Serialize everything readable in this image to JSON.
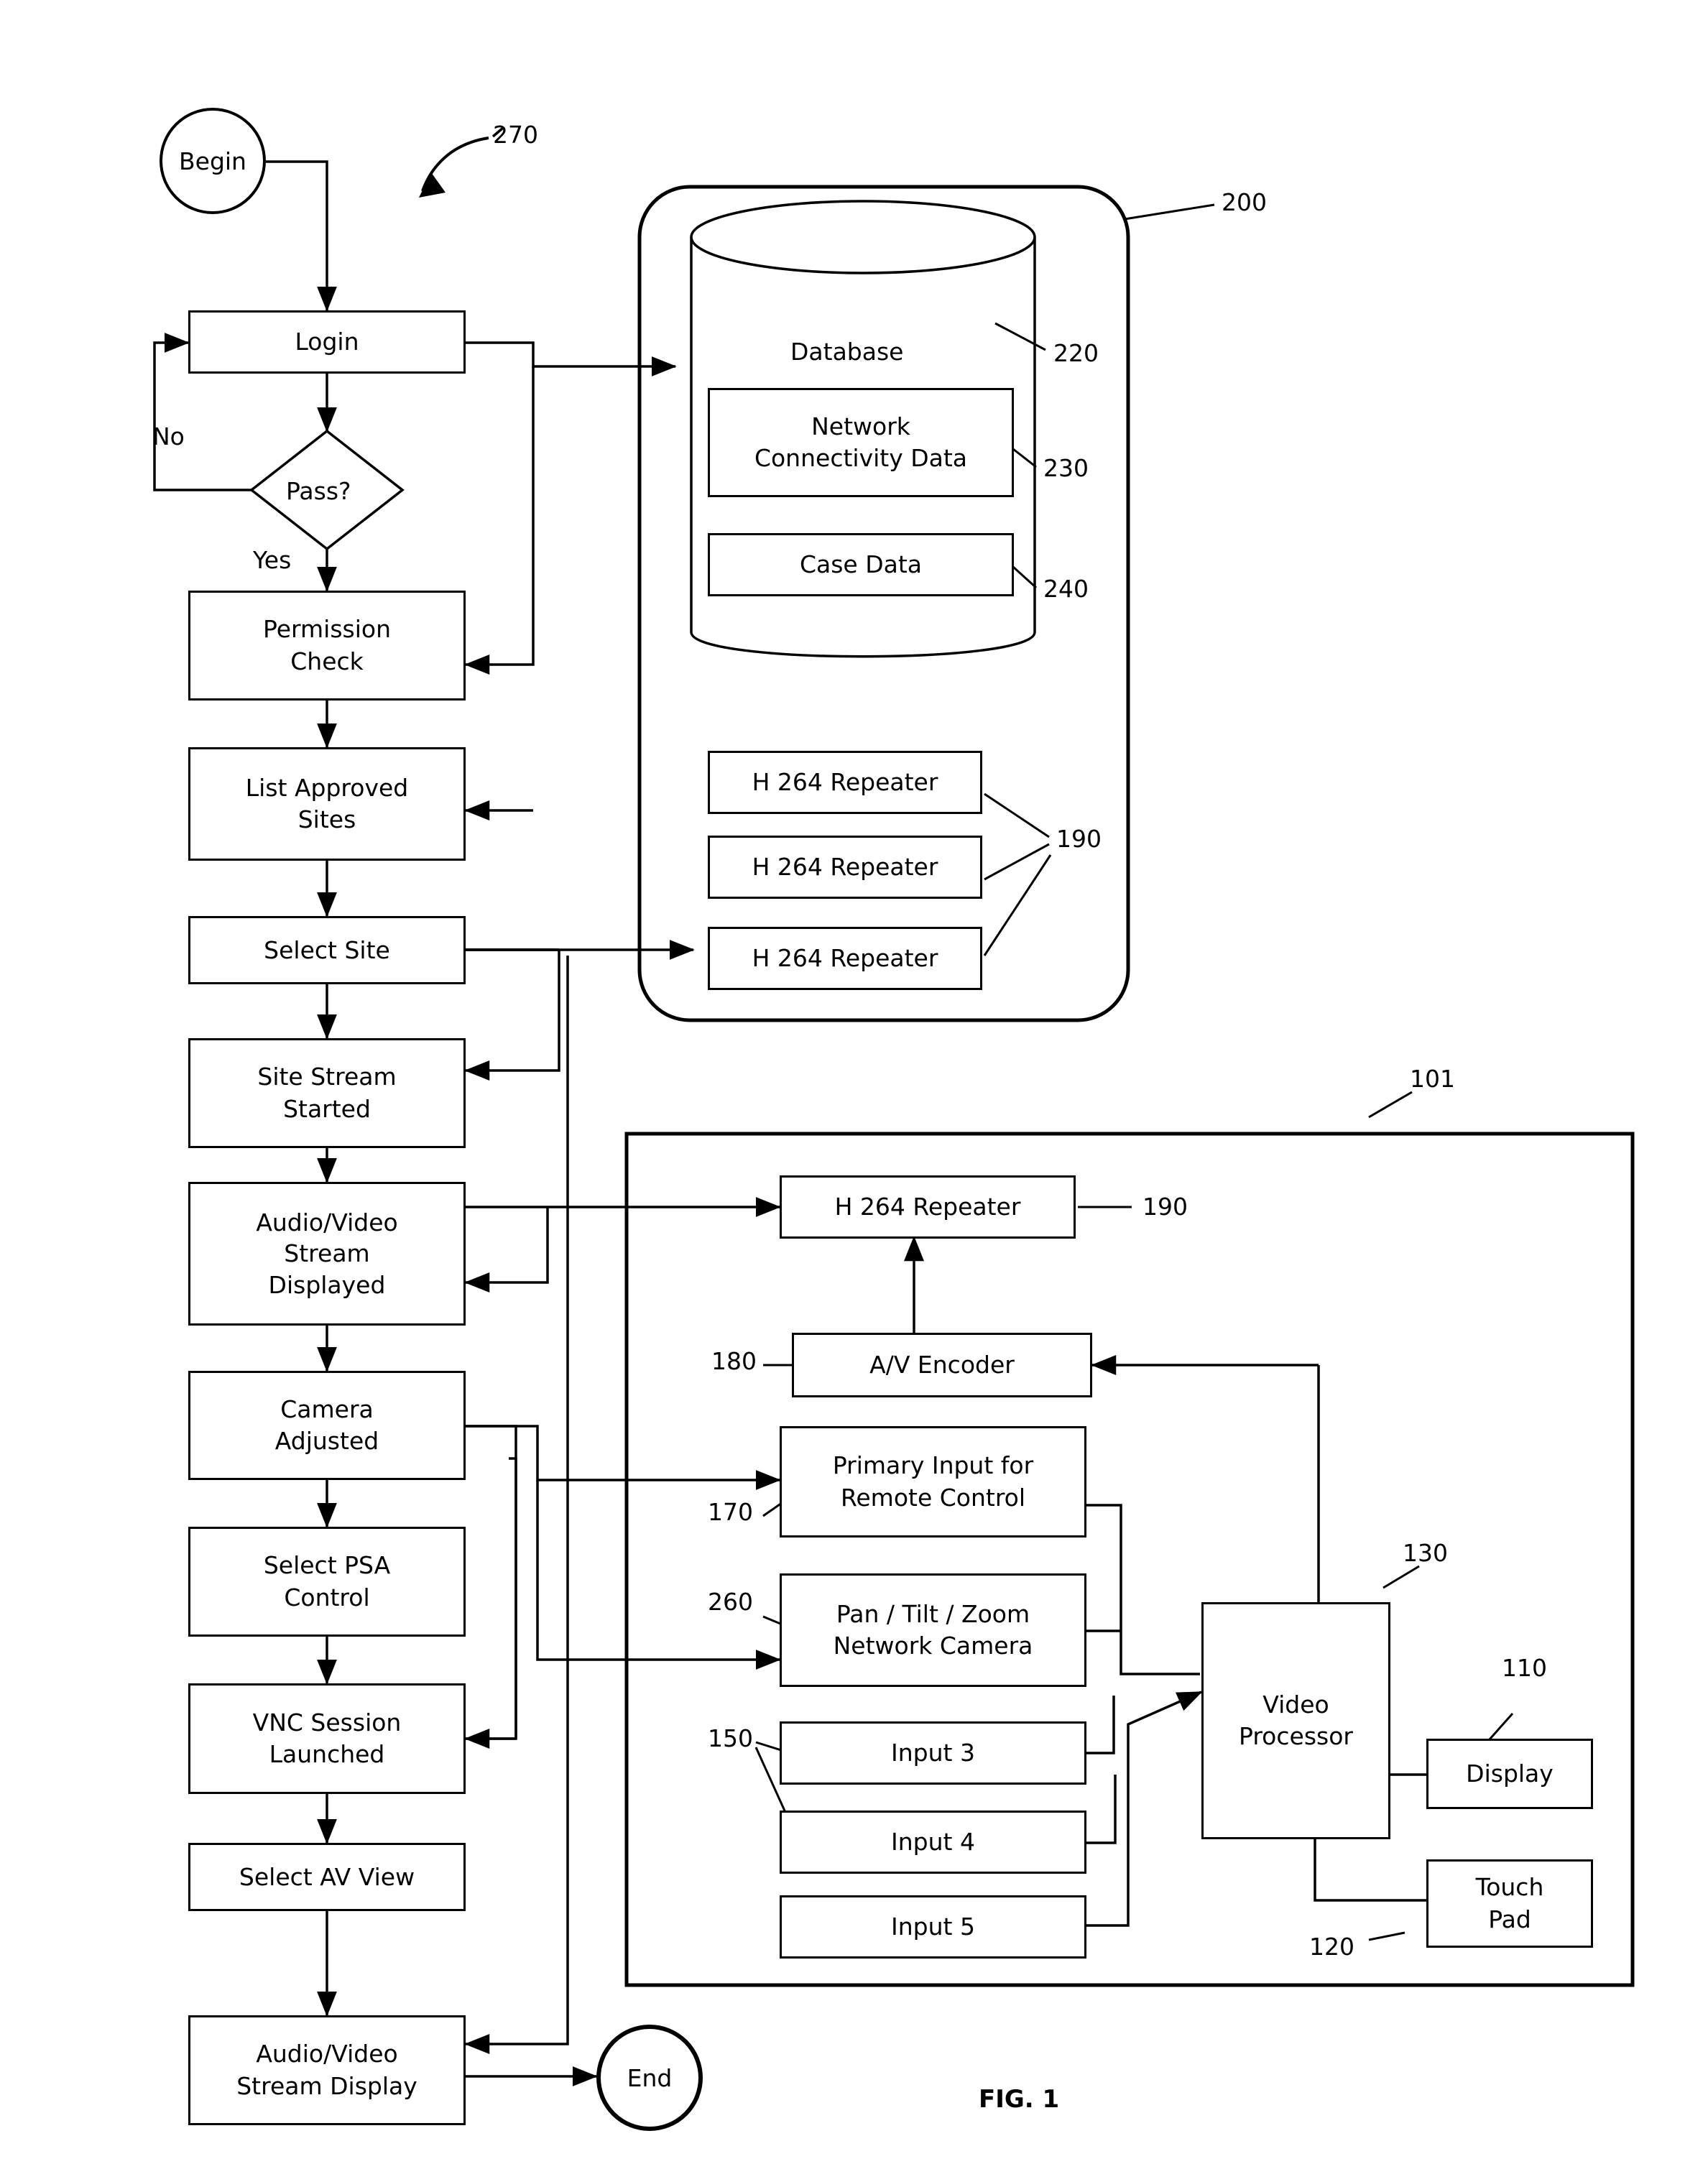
{
  "figure": {
    "caption": "FIG. 1",
    "flow_ref": "270",
    "server_ref": "200",
    "client_ref": "101"
  },
  "flow": {
    "begin": "Begin",
    "end": "End",
    "decision": "Pass?",
    "decision_no": "No",
    "decision_yes": "Yes",
    "steps": [
      {
        "label": "Login"
      },
      {
        "label": "Permission\nCheck",
        "line1": "Permission",
        "line2": "Check"
      },
      {
        "label": "List Approved\nSites",
        "line1": "List Approved",
        "line2": "Sites"
      },
      {
        "label": "Select Site"
      },
      {
        "label": "Site Stream\nStarted",
        "line1": "Site Stream",
        "line2": "Started"
      },
      {
        "label": "Audio/Video\nStream\nDisplayed",
        "line1": "Audio/Video",
        "line2": "Stream",
        "line3": "Displayed"
      },
      {
        "label": "Camera\nAdjusted",
        "line1": "Camera",
        "line2": "Adjusted"
      },
      {
        "label": "Select PSA\nControl",
        "line1": "Select PSA",
        "line2": "Control"
      },
      {
        "label": "VNC Session\nLaunched",
        "line1": "VNC Session",
        "line2": "Launched"
      },
      {
        "label": "Select AV View"
      },
      {
        "label": "Audio/Video\nStream Display",
        "line1": "Audio/Video",
        "line2": "Stream Display"
      }
    ]
  },
  "server": {
    "database_label": "Database",
    "database_ref": "220",
    "items": [
      {
        "label": "Network\nConnectivity Data",
        "line1": "Network",
        "line2": "Connectivity Data",
        "ref": "230"
      },
      {
        "label": "Case Data",
        "ref": "240"
      }
    ],
    "repeaters": [
      {
        "label": "H 264 Repeater"
      },
      {
        "label": "H 264 Repeater"
      },
      {
        "label": "H 264 Repeater"
      }
    ],
    "repeater_ref": "190"
  },
  "client": {
    "repeater": {
      "label": "H 264 Repeater",
      "ref": "190"
    },
    "encoder": {
      "label": "A/V Encoder",
      "ref": "180"
    },
    "primary_input": {
      "line1": "Primary Input for",
      "line2": "Remote Control",
      "ref": "170"
    },
    "ptz_camera": {
      "line1": "Pan / Tilt / Zoom",
      "line2": "Network Camera",
      "ref": "260"
    },
    "inputs": [
      {
        "label": "Input 3"
      },
      {
        "label": "Input 4"
      },
      {
        "label": "Input 5"
      }
    ],
    "inputs_ref": "150",
    "video_processor": {
      "line1": "Video",
      "line2": "Processor",
      "ref": "130"
    },
    "display": {
      "label": "Display",
      "ref": "110"
    },
    "touch_pad": {
      "line1": "Touch",
      "line2": "Pad",
      "ref": "120"
    }
  }
}
